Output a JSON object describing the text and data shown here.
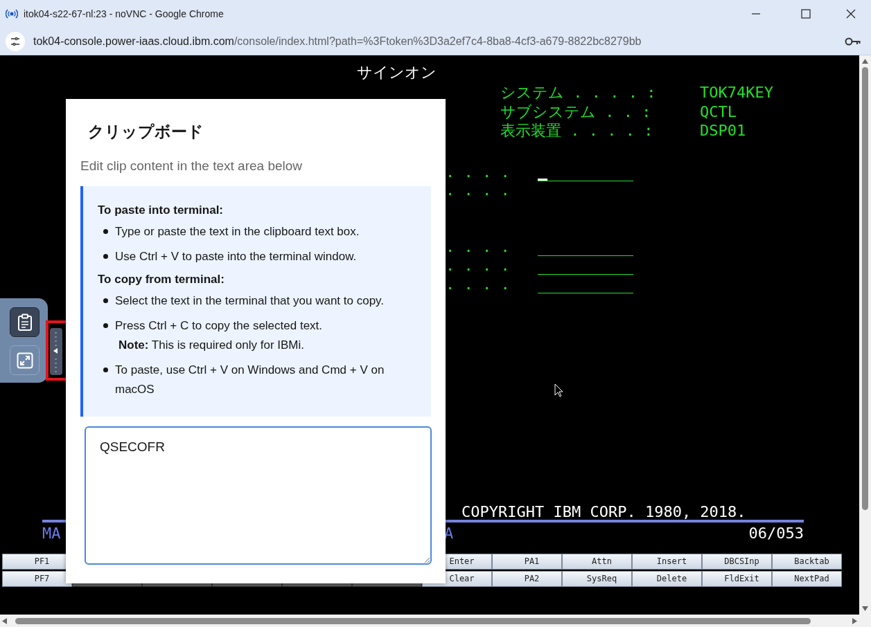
{
  "browser": {
    "title": "itok04-s22-67-nl:23 - noVNC - Google Chrome",
    "url_host": "tok04-console.power-iaas.cloud.ibm.com",
    "url_path": "/console/index.html?path=%3Ftoken%3D3a2ef7c4-8ba8-4cf3-a679-8822bc8279bb"
  },
  "terminal": {
    "heading": "サインオン",
    "system_info": [
      {
        "label": "システム . . . . :",
        "value": "TOK74KEY"
      },
      {
        "label": "サブシステム . . :",
        "value": "QCTL"
      },
      {
        "label": "表示装置 . . . . :",
        "value": "DSP01"
      }
    ],
    "fields": [
      {
        "dots": ". . . .",
        "kind": "input",
        "cursor": true
      },
      {
        "dots": ". . . .",
        "kind": "none",
        "cursor": false
      },
      {
        "dots": ". . . .",
        "kind": "input",
        "cursor": false
      },
      {
        "dots": ". . . .",
        "kind": "input",
        "cursor": false
      },
      {
        "dots": ". . . .",
        "kind": "input",
        "cursor": false
      }
    ],
    "copyright": "COPYRIGHT IBM CORP. 1980, 2018.",
    "status_left": "MA",
    "status_mid": "A",
    "position": "06/053",
    "keys": [
      [
        {
          "kind": "key",
          "label": "PF1"
        },
        {
          "kind": "hidden"
        },
        {
          "kind": "hidden"
        },
        {
          "kind": "hidden"
        },
        {
          "kind": "hidden"
        },
        {
          "kind": "hidden"
        },
        {
          "kind": "key",
          "label": "Enter"
        },
        {
          "kind": "key",
          "label": "PA1"
        },
        {
          "kind": "key",
          "label": "Attn"
        },
        {
          "kind": "key",
          "label": "Insert"
        },
        {
          "kind": "key",
          "label": "DBCSInp"
        },
        {
          "kind": "key",
          "label": "Backtab"
        }
      ],
      [
        {
          "kind": "key",
          "label": "PF7"
        },
        {
          "kind": "covered"
        },
        {
          "kind": "covered"
        },
        {
          "kind": "covered"
        },
        {
          "kind": "covered"
        },
        {
          "kind": "covered"
        },
        {
          "kind": "key",
          "label": "Clear"
        },
        {
          "kind": "key",
          "label": "PA2"
        },
        {
          "kind": "key",
          "label": "SysReq"
        },
        {
          "kind": "key",
          "label": "Delete"
        },
        {
          "kind": "key",
          "label": "FldExit"
        },
        {
          "kind": "key",
          "label": "NextPad"
        }
      ]
    ]
  },
  "side_panel": {
    "buttons": [
      {
        "kind": "clipboard",
        "selected": true
      },
      {
        "kind": "fullscreen",
        "selected": false
      }
    ]
  },
  "clipboard": {
    "title": "クリップボード",
    "subtitle": "Edit clip content in the text area below",
    "sections": [
      {
        "heading": "To paste into terminal:",
        "items": [
          {
            "text": "Type or paste the text in the clipboard text box."
          },
          {
            "text": "Use Ctrl + V to paste into the terminal window."
          }
        ]
      },
      {
        "heading": "To copy from terminal:",
        "items": [
          {
            "text": "Select the text in the terminal that you want to copy."
          },
          {
            "text": "Press Ctrl + C to copy the selected text.",
            "note": "**Note:** This is required only for IBMi."
          },
          {
            "text": "To paste, use Ctrl + V on Windows and Cmd + V on macOS"
          }
        ]
      }
    ],
    "value": "QSECOFR"
  }
}
